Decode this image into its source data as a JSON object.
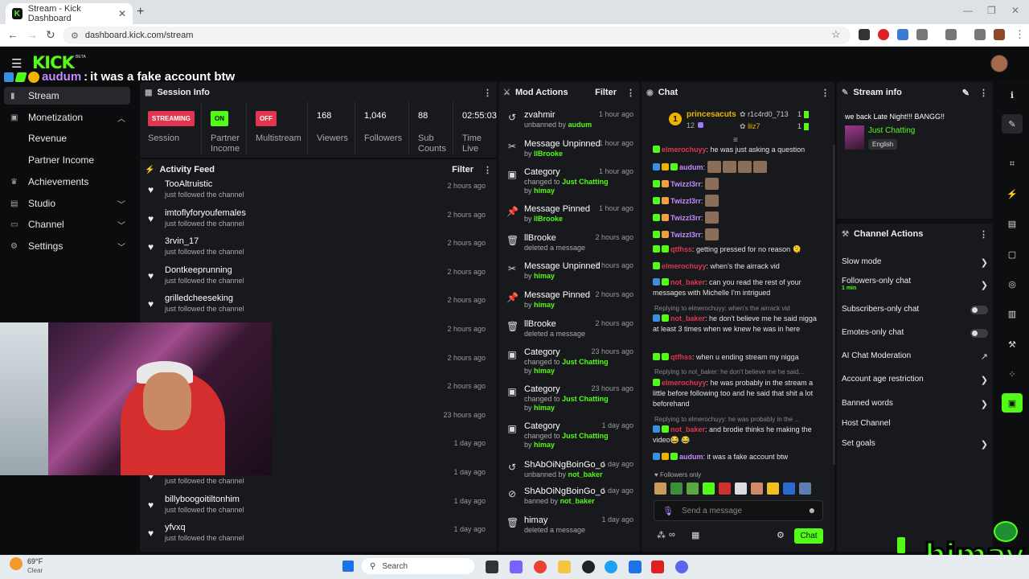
{
  "browser": {
    "tab_title": "Stream - Kick Dashboard",
    "tab_favicon": "K",
    "new_tab": "+",
    "url": "dashboard.kick.com/stream"
  },
  "header": {
    "logo": "KICK",
    "beta": "BETA"
  },
  "overlay": {
    "user": "audum",
    "sep": ":",
    "text": "it was a fake account btw"
  },
  "sidebar": {
    "items": [
      {
        "label": "Stream",
        "icon": "broadcast-icon"
      },
      {
        "label": "Monetization",
        "icon": "dollar-icon"
      },
      {
        "label": "Revenue"
      },
      {
        "label": "Partner Income"
      },
      {
        "label": "Achievements",
        "icon": "trophy-icon"
      },
      {
        "label": "Studio",
        "icon": "studio-icon"
      },
      {
        "label": "Channel",
        "icon": "channel-icon"
      },
      {
        "label": "Settings",
        "icon": "gear-icon"
      }
    ]
  },
  "session": {
    "title": "Session Info",
    "streaming_pill": "STREAMING",
    "on_pill": "ON",
    "off_pill": "OFF",
    "session_label": "Session",
    "partner_label": "Partner Income",
    "multistream_label": "Multistream",
    "viewers": "168",
    "viewers_label": "Viewers",
    "followers": "1,046",
    "followers_label": "Followers",
    "subs": "88",
    "subs_label": "Sub Counts",
    "time": "02:55:03",
    "time_label": "Time Live"
  },
  "activity": {
    "title": "Activity Feed",
    "filter": "Filter",
    "rows": [
      {
        "name": "TooAltruistic",
        "action": "just followed the channel",
        "time": "2 hours ago"
      },
      {
        "name": "imtoflyforyoufemales",
        "action": "just followed the channel",
        "time": "2 hours ago"
      },
      {
        "name": "3rvin_17",
        "action": "just followed the channel",
        "time": "2 hours ago"
      },
      {
        "name": "Dontkeeprunning",
        "action": "just followed the channel",
        "time": "2 hours ago"
      },
      {
        "name": "grilledcheeseking",
        "action": "just followed the channel",
        "time": "2 hours ago"
      },
      {
        "name": "",
        "action": "",
        "time": "2 hours ago"
      },
      {
        "name": "",
        "action": "",
        "time": "2 hours ago"
      },
      {
        "name": "",
        "action": "",
        "time": "2 hours ago"
      },
      {
        "name": "",
        "action": "",
        "time": "23 hours ago"
      },
      {
        "name": "",
        "action": "",
        "time": "1 day ago"
      },
      {
        "name": "",
        "action": "just followed the channel",
        "time": "1 day ago"
      },
      {
        "name": "billyboogoitiltonhim",
        "action": "just followed the channel",
        "time": "1 day ago"
      },
      {
        "name": "yfvxq",
        "action": "just followed the channel",
        "time": "1 day ago"
      }
    ]
  },
  "mod": {
    "title": "Mod Actions",
    "filter": "Filter",
    "rows": [
      {
        "icon": "undo-icon",
        "title": "zvahmir",
        "pre": "unbanned by",
        "who": "audum",
        "post": "",
        "time": "1 hour ago"
      },
      {
        "icon": "unpin-icon",
        "title": "Message Unpinned",
        "pre": "by",
        "who": "llBrooke",
        "post": "",
        "time": "1 hour ago"
      },
      {
        "icon": "category-icon",
        "title": "Category",
        "pre": "changed to",
        "who": "Just Chatting",
        "post": "by",
        "who2": "himay",
        "time": "1 hour ago"
      },
      {
        "icon": "pin-icon",
        "title": "Message Pinned",
        "pre": "by",
        "who": "llBrooke",
        "post": "",
        "time": "1 hour ago"
      },
      {
        "icon": "trash-icon",
        "title": "llBrooke",
        "pre": "deleted a message",
        "who": "",
        "post": "",
        "time": "2 hours ago"
      },
      {
        "icon": "unpin-icon",
        "title": "Message Unpinned",
        "pre": "by",
        "who": "himay",
        "post": "",
        "time": "2 hours ago"
      },
      {
        "icon": "pin-icon",
        "title": "Message Pinned",
        "pre": "by",
        "who": "himay",
        "post": "",
        "time": "2 hours ago"
      },
      {
        "icon": "trash-icon",
        "title": "llBrooke",
        "pre": "deleted a message",
        "who": "",
        "post": "",
        "time": "2 hours ago"
      },
      {
        "icon": "category-icon",
        "title": "Category",
        "pre": "changed to",
        "who": "Just Chatting",
        "post": "by",
        "who2": "himay",
        "time": "23 hours ago"
      },
      {
        "icon": "category-icon",
        "title": "Category",
        "pre": "changed to",
        "who": "Just Chatting",
        "post": "by",
        "who2": "himay",
        "time": "23 hours ago"
      },
      {
        "icon": "category-icon",
        "title": "Category",
        "pre": "changed to",
        "who": "Just Chatting",
        "post": "by",
        "who2": "himay",
        "time": "1 day ago"
      },
      {
        "icon": "undo-icon",
        "title": "ShAbOiNgBoinGo_o",
        "pre": "unbanned by",
        "who": "not_baker",
        "post": "",
        "time": "1 day ago"
      },
      {
        "icon": "ban-icon",
        "title": "ShAbOiNgBoinGo_o",
        "pre": "banned by",
        "who": "not_baker",
        "post": "",
        "time": "1 day ago"
      },
      {
        "icon": "trash-icon",
        "title": "himay",
        "pre": "deleted a message",
        "who": "",
        "post": "",
        "time": "1 day ago"
      }
    ]
  },
  "chat": {
    "title": "Chat",
    "top_gifter": {
      "rank": "1",
      "name": "princesacuts",
      "count": "12"
    },
    "gifters": [
      {
        "name": "r1c4rd0_713",
        "count": "1"
      },
      {
        "name": "liiz7",
        "count": "1"
      }
    ],
    "messages": [
      {
        "user": "elmerochuyy",
        "color": "#e0364f",
        "text": "he was just asking a question"
      },
      {
        "user": "audum",
        "color": "#c58cff",
        "text": ""
      },
      {
        "user": "Twizzl3rr",
        "color": "#c58cff",
        "text": ""
      },
      {
        "user": "Twizzl3rr",
        "color": "#c58cff",
        "text": ""
      },
      {
        "user": "Twizzl3rr",
        "color": "#c58cff",
        "text": ""
      },
      {
        "user": "Twizzl3rr",
        "color": "#c58cff",
        "text": ""
      },
      {
        "user": "qtfhss",
        "color": "#e0364f",
        "text": "getting pressed for no reason 🫠"
      },
      {
        "user": "elmerochuyy",
        "color": "#e0364f",
        "text": "when's the airrack vid"
      },
      {
        "user": "not_baker",
        "color": "#e0364f",
        "text": "can you read the rest of your messages with Michelle I'm intrigued"
      },
      {
        "user": "not_baker",
        "color": "#e0364f",
        "text": "he don't believe me he said nigga at least 3 times when we knew he was in here"
      },
      {
        "user": "qtfhss",
        "color": "#e0364f",
        "text": "when u ending stream my nigga"
      },
      {
        "user": "elmerochuyy",
        "color": "#e0364f",
        "text": "he was probably in the stream a little before following too and he said that shit a lot beforehand"
      },
      {
        "user": "not_baker",
        "color": "#e0364f",
        "text": "and brodie thinks he making the video😂 😂"
      },
      {
        "user": "audum",
        "color": "#c58cff",
        "text": "it was a fake account btw"
      }
    ],
    "replies": [
      "Replying to elmerochuyy: when's the airrack vid",
      "Replying to not_baker: he don't believe me he said...",
      "Replying to elmerochuyy: he was probably in the ..."
    ],
    "followers_only": "Followers only",
    "placeholder": "Send a message",
    "send": "Chat"
  },
  "stream_info": {
    "title": "Stream info",
    "stream_title": "we back Late Night!!! BANGG!!",
    "category": "Just Chatting",
    "language": "English"
  },
  "channel_actions": {
    "title": "Channel Actions",
    "slow": "Slow mode",
    "followers_only": "Followers-only chat",
    "followers_only_sub": "1 min",
    "subscribers_only": "Subscribers-only chat",
    "emotes_only": "Emotes-only chat",
    "ai_mod": "AI Chat Moderation",
    "age": "Account age restriction",
    "banned": "Banned words",
    "host": "Host Channel",
    "goals": "Set goals"
  },
  "taskbar": {
    "weather_temp": "69°F",
    "weather_desc": "Clear",
    "search": "Search"
  },
  "watermark": "himay",
  "colors": {
    "accent": "#53fc18",
    "streaming": "#e0364f",
    "panel": "#18191c"
  }
}
